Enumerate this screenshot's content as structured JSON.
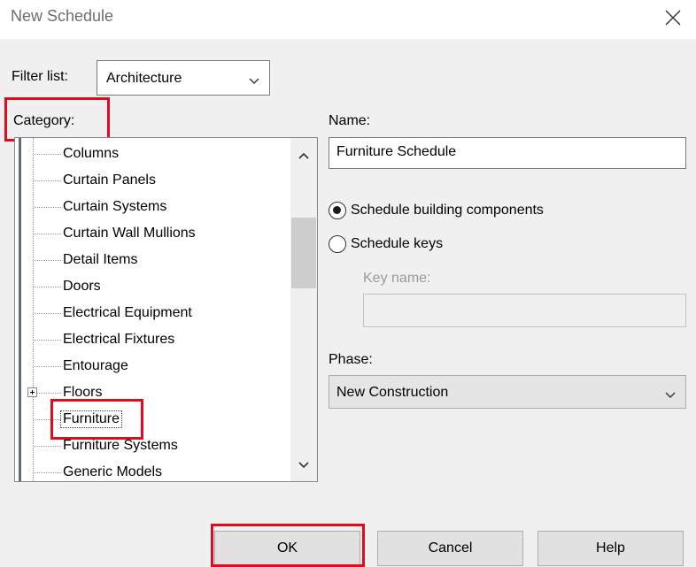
{
  "window": {
    "title": "New Schedule"
  },
  "filter": {
    "label": "Filter list:",
    "value": "Architecture"
  },
  "category": {
    "label": "Category:",
    "items": [
      {
        "label": "Columns",
        "selected": false,
        "expandable": false
      },
      {
        "label": "Curtain Panels",
        "selected": false,
        "expandable": false
      },
      {
        "label": "Curtain Systems",
        "selected": false,
        "expandable": false
      },
      {
        "label": "Curtain Wall Mullions",
        "selected": false,
        "expandable": false
      },
      {
        "label": "Detail Items",
        "selected": false,
        "expandable": false
      },
      {
        "label": "Doors",
        "selected": false,
        "expandable": false
      },
      {
        "label": "Electrical Equipment",
        "selected": false,
        "expandable": false
      },
      {
        "label": "Electrical Fixtures",
        "selected": false,
        "expandable": false
      },
      {
        "label": "Entourage",
        "selected": false,
        "expandable": false
      },
      {
        "label": "Floors",
        "selected": false,
        "expandable": true
      },
      {
        "label": "Furniture",
        "selected": true,
        "expandable": false
      },
      {
        "label": "Furniture Systems",
        "selected": false,
        "expandable": false
      },
      {
        "label": "Generic Models",
        "selected": false,
        "expandable": false
      }
    ]
  },
  "name": {
    "label": "Name:",
    "value": "Furniture Schedule"
  },
  "schedule_type": {
    "options": [
      {
        "label": "Schedule building components",
        "checked": true
      },
      {
        "label": "Schedule keys",
        "checked": false
      }
    ]
  },
  "key_name": {
    "label": "Key name:",
    "value": ""
  },
  "phase": {
    "label": "Phase:",
    "value": "New Construction"
  },
  "buttons": {
    "ok": "OK",
    "cancel": "Cancel",
    "help": "Help"
  },
  "colors": {
    "highlight_border": "#e10a1f",
    "dialog_bg": "#f0f0f0",
    "button_bg": "#e1e1e1"
  }
}
